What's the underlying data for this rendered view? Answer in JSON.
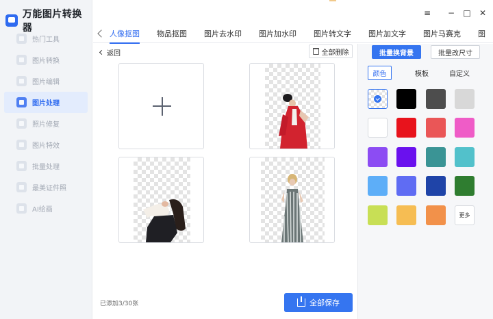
{
  "app": {
    "title": "万能图片转换器"
  },
  "sidebar": {
    "items": [
      {
        "label": "热门工具",
        "active": false
      },
      {
        "label": "图片转换",
        "active": false
      },
      {
        "label": "图片编辑",
        "active": false
      },
      {
        "label": "图片处理",
        "active": true
      },
      {
        "label": "照片修复",
        "active": false
      },
      {
        "label": "图片特效",
        "active": false
      },
      {
        "label": "批量处理",
        "active": false
      },
      {
        "label": "最美证件照",
        "active": false
      },
      {
        "label": "AI绘画",
        "active": false
      }
    ]
  },
  "window": {
    "menu_icon": "≡",
    "minimize_icon": "−",
    "maximize_icon": "□",
    "close_icon": "✕"
  },
  "tabs": {
    "items": [
      {
        "label": "人像抠图",
        "active": true
      },
      {
        "label": "物品抠图",
        "active": false
      },
      {
        "label": "图片去水印",
        "active": false
      },
      {
        "label": "图片加水印",
        "active": false
      },
      {
        "label": "图片转文字",
        "active": false
      },
      {
        "label": "图片加文字",
        "active": false
      },
      {
        "label": "图片马赛克",
        "active": false
      },
      {
        "label": "图",
        "active": false
      }
    ]
  },
  "main": {
    "back_label": "返回",
    "delete_all_label": "全部删除",
    "status": "已添加3/30张",
    "save_all_label": "全部保存",
    "images": [
      {
        "name": "woman-red-hanfu"
      },
      {
        "name": "woman-crouching"
      },
      {
        "name": "woman-striped-dress"
      }
    ]
  },
  "panel": {
    "mode_buttons": {
      "batch_background": "批量换背景",
      "batch_resize": "批量改尺寸"
    },
    "sub_tabs": [
      {
        "label": "颜色",
        "active": true
      },
      {
        "label": "模板",
        "active": false
      },
      {
        "label": "自定义",
        "active": false
      }
    ],
    "selected_color": "transparent",
    "colors": [
      "transparent",
      "#000000",
      "#4d4d4d",
      "#d8d8d8",
      "#ffffff",
      "#e8131c",
      "#ea5657",
      "#ef5cc7",
      "#8c4cf3",
      "#6a11ee",
      "#3a9495",
      "#52c1cb",
      "#5daef8",
      "#5f6cf3",
      "#1f44a8",
      "#2f7d30",
      "#c8df55",
      "#f6bd53",
      "#f2914a"
    ],
    "more_label": "更多"
  }
}
